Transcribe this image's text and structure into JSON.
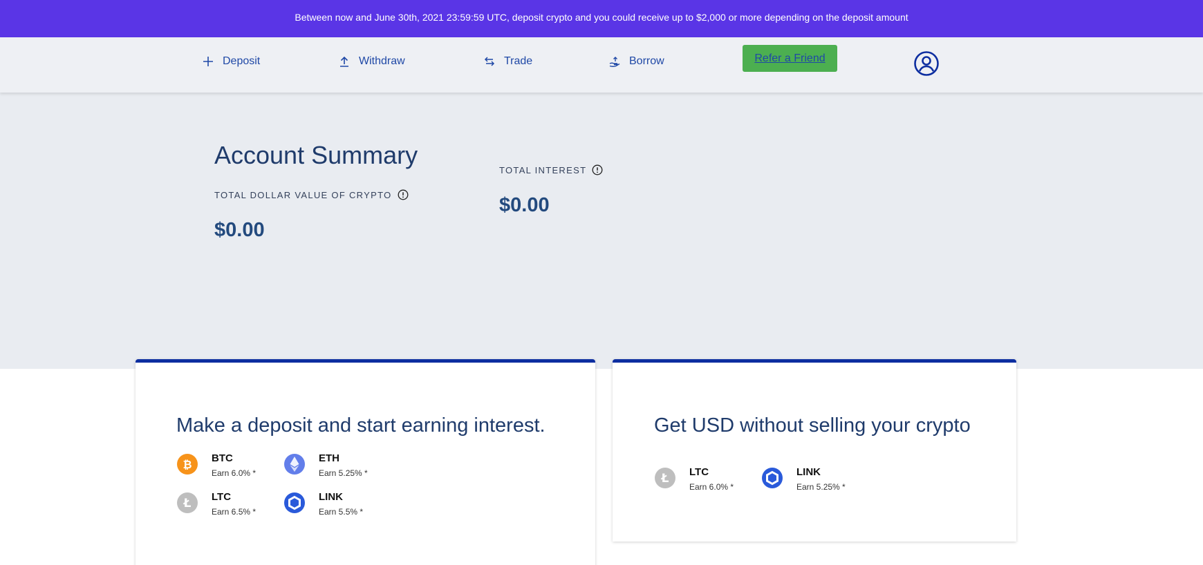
{
  "promo": {
    "text": "Between now and June 30th, 2021 23:59:59 UTC, deposit crypto and you could receive up to $2,000 or more depending on the deposit amount"
  },
  "nav": {
    "items": [
      {
        "label": "Deposit",
        "icon": "plus-icon"
      },
      {
        "label": "Withdraw",
        "icon": "upload-icon"
      },
      {
        "label": "Trade",
        "icon": "swap-arrows-icon"
      },
      {
        "label": "Borrow",
        "icon": "borrow-hand-icon"
      }
    ],
    "refer_label": "Refer a Friend",
    "avatar_icon": "user-circle-icon"
  },
  "summary": {
    "title": "Account Summary",
    "total_value_label": "TOTAL DOLLAR VALUE OF CRYPTO",
    "total_value": "$0.00",
    "total_interest_label": "TOTAL INTEREST",
    "total_interest": "$0.00",
    "info_icon": "info-circle-icon"
  },
  "deposit_card": {
    "title": "Make a deposit and start earning interest.",
    "coins": [
      {
        "symbol": "BTC",
        "earn": "Earn 6.0% *",
        "icon": "bitcoin-icon",
        "color": "#f7931a"
      },
      {
        "symbol": "ETH",
        "earn": "Earn 5.25% *",
        "icon": "ethereum-icon",
        "color": "#627eea"
      },
      {
        "symbol": "LTC",
        "earn": "Earn 6.5% *",
        "icon": "litecoin-icon",
        "color": "#bebebe"
      },
      {
        "symbol": "LINK",
        "earn": "Earn 5.5% *",
        "icon": "chainlink-icon",
        "color": "#2a5ada"
      }
    ]
  },
  "borrow_card": {
    "title": "Get USD without selling your crypto",
    "coins": [
      {
        "symbol": "LTC",
        "earn": "Earn 6.0% *",
        "icon": "litecoin-icon",
        "color": "#bebebe"
      },
      {
        "symbol": "LINK",
        "earn": "Earn 5.25% *",
        "icon": "chainlink-icon",
        "color": "#2a5ada"
      }
    ]
  },
  "colors": {
    "promo_bg": "#5a35e6",
    "nav_bg": "#eef0f4",
    "summary_bg": "#e9ecf1",
    "accent": "#1f48a6",
    "refer_bg": "#4caf50",
    "card_border": "#0d2ea0"
  }
}
